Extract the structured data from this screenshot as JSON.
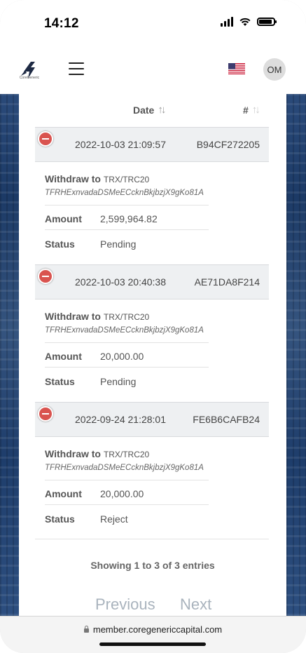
{
  "status_bar": {
    "time": "14:12"
  },
  "header": {
    "brand": "CoreGeneric",
    "avatar_initials": "OM"
  },
  "table": {
    "col_date": "Date",
    "col_id": "#",
    "entries": [
      {
        "date": "2022-10-03 21:09:57",
        "id": "B94CF272205",
        "withdraw_label": "Withdraw to",
        "network": "TRX/TRC20",
        "address": "TFRHExnvadaDSMeECcknBkjbzjX9gKo81A",
        "amount_label": "Amount",
        "amount": "2,599,964.82",
        "status_label": "Status",
        "status": "Pending"
      },
      {
        "date": "2022-10-03 20:40:38",
        "id": "AE71DA8F214",
        "withdraw_label": "Withdraw to",
        "network": "TRX/TRC20",
        "address": "TFRHExnvadaDSMeECcknBkjbzjX9gKo81A",
        "amount_label": "Amount",
        "amount": "20,000.00",
        "status_label": "Status",
        "status": "Pending"
      },
      {
        "date": "2022-09-24 21:28:01",
        "id": "FE6B6CAFB24",
        "withdraw_label": "Withdraw to",
        "network": "TRX/TRC20",
        "address": "TFRHExnvadaDSMeECcknBkjbzjX9gKo81A",
        "amount_label": "Amount",
        "amount": "20,000.00",
        "status_label": "Status",
        "status": "Reject"
      }
    ]
  },
  "footer": {
    "showing": "Showing 1 to 3 of 3 entries",
    "previous": "Previous",
    "next": "Next"
  },
  "browser": {
    "url": "member.coregenericcapital.com"
  },
  "colors": {
    "expand_button": "#d9534f",
    "row_header_bg": "#eef0f2",
    "pager_text": "#a9b3bd"
  },
  "icons": [
    "signal-icon",
    "wifi-icon",
    "battery-icon",
    "logo-icon",
    "hamburger-menu-icon",
    "us-flag-icon",
    "sort-icon",
    "expand-collapse-icon",
    "lock-icon"
  ]
}
